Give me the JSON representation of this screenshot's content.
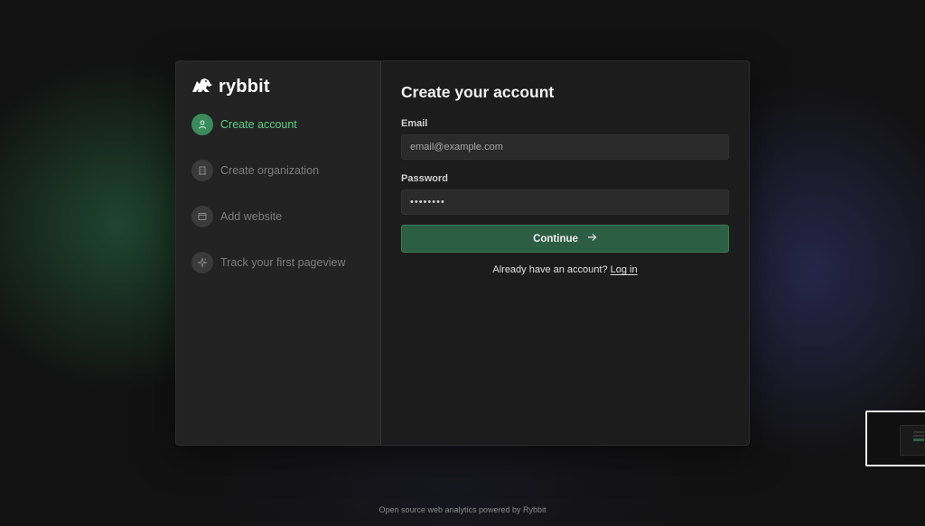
{
  "brand": {
    "name": "rybbit"
  },
  "steps": [
    {
      "label": "Create account",
      "icon": "user-icon",
      "active": true
    },
    {
      "label": "Create organization",
      "icon": "building-icon",
      "active": false
    },
    {
      "label": "Add website",
      "icon": "browser-window-icon",
      "active": false
    },
    {
      "label": "Track your first pageview",
      "icon": "sparkle-icon",
      "active": false
    }
  ],
  "form": {
    "title": "Create your account",
    "email_label": "Email",
    "email_placeholder": "email@example.com",
    "email_value": "",
    "password_label": "Password",
    "password_value": "••••••••",
    "continue_label": "Continue",
    "login_prompt": "Already have an account?",
    "login_link": "Log in"
  },
  "footer": {
    "text": "Open source web analytics powered by Rybbit"
  },
  "colors": {
    "accent": "#5cd08a",
    "button_bg": "#2c5e44",
    "card_bg": "#1c1c1c",
    "sidebar_bg": "#222222"
  }
}
